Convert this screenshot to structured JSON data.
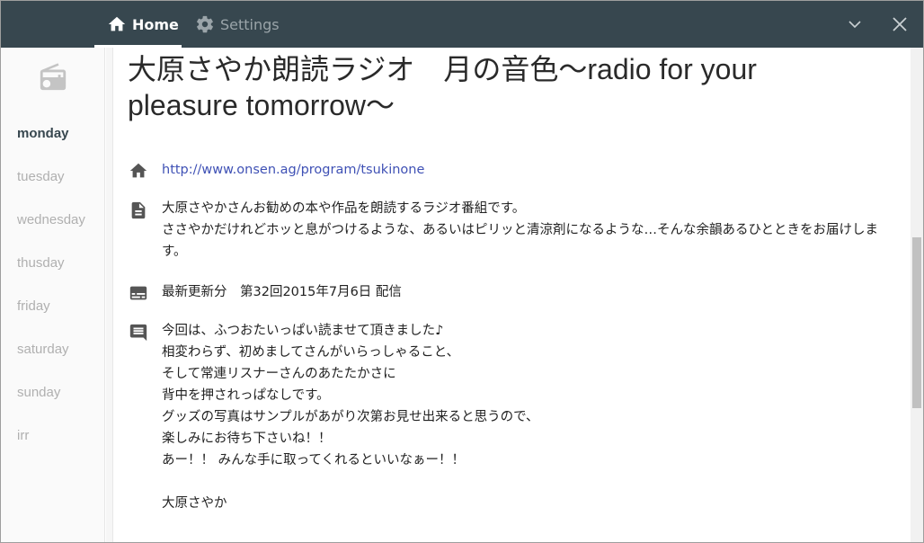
{
  "titlebar": {
    "tabs": [
      {
        "label": "Home",
        "icon": "home-icon",
        "active": true
      },
      {
        "label": "Settings",
        "icon": "gear-icon",
        "active": false
      }
    ],
    "controls": {
      "minimize_icon": "chevron-down-icon",
      "close_icon": "close-icon"
    },
    "colors": {
      "background": "#37474f",
      "active_text": "#ffffff",
      "inactive_text": "#9aa4a9"
    }
  },
  "sidebar": {
    "icon": "radio-icon",
    "days": [
      {
        "label": "monday",
        "active": true
      },
      {
        "label": "tuesday",
        "active": false
      },
      {
        "label": "wednesday",
        "active": false
      },
      {
        "label": "thusday",
        "active": false
      },
      {
        "label": "friday",
        "active": false
      },
      {
        "label": "saturday",
        "active": false
      },
      {
        "label": "sunday",
        "active": false
      },
      {
        "label": "irr",
        "active": false
      }
    ]
  },
  "program": {
    "title": "大原さやか朗読ラジオ　月の音色～radio for your pleasure tomorrow～",
    "homepage": {
      "icon": "home-icon",
      "url": "http://www.onsen.ag/program/tsukinone"
    },
    "description": {
      "icon": "document-icon",
      "lines": [
        "大原さやかさんお勧めの本や作品を朗読するラジオ番組です。",
        "ささやかだけれどホッと息がつけるような、あるいはピリッと清涼剤になるような…そんな余韻あるひとときをお届けしま",
        "す。"
      ]
    },
    "latest": {
      "icon": "subtitles-icon",
      "text": "最新更新分　第32回2015年7月6日 配信"
    },
    "message": {
      "icon": "comment-icon",
      "lines": [
        "今回は、ふつおたいっぱい読ませて頂きました♪",
        "相変わらず、初めましてさんがいらっしゃること、",
        "そして常連リスナーさんのあたたかさに",
        "背中を押されっぱなしです。",
        "グッズの写真はサンプルがあがり次第お見せ出来ると思うので、",
        "楽しみにお待ち下さいね！！",
        "あー！！ みんな手に取ってくれるといいなぁー！！",
        "",
        "大原さやか"
      ]
    }
  },
  "accent_color": "#3f51b5"
}
